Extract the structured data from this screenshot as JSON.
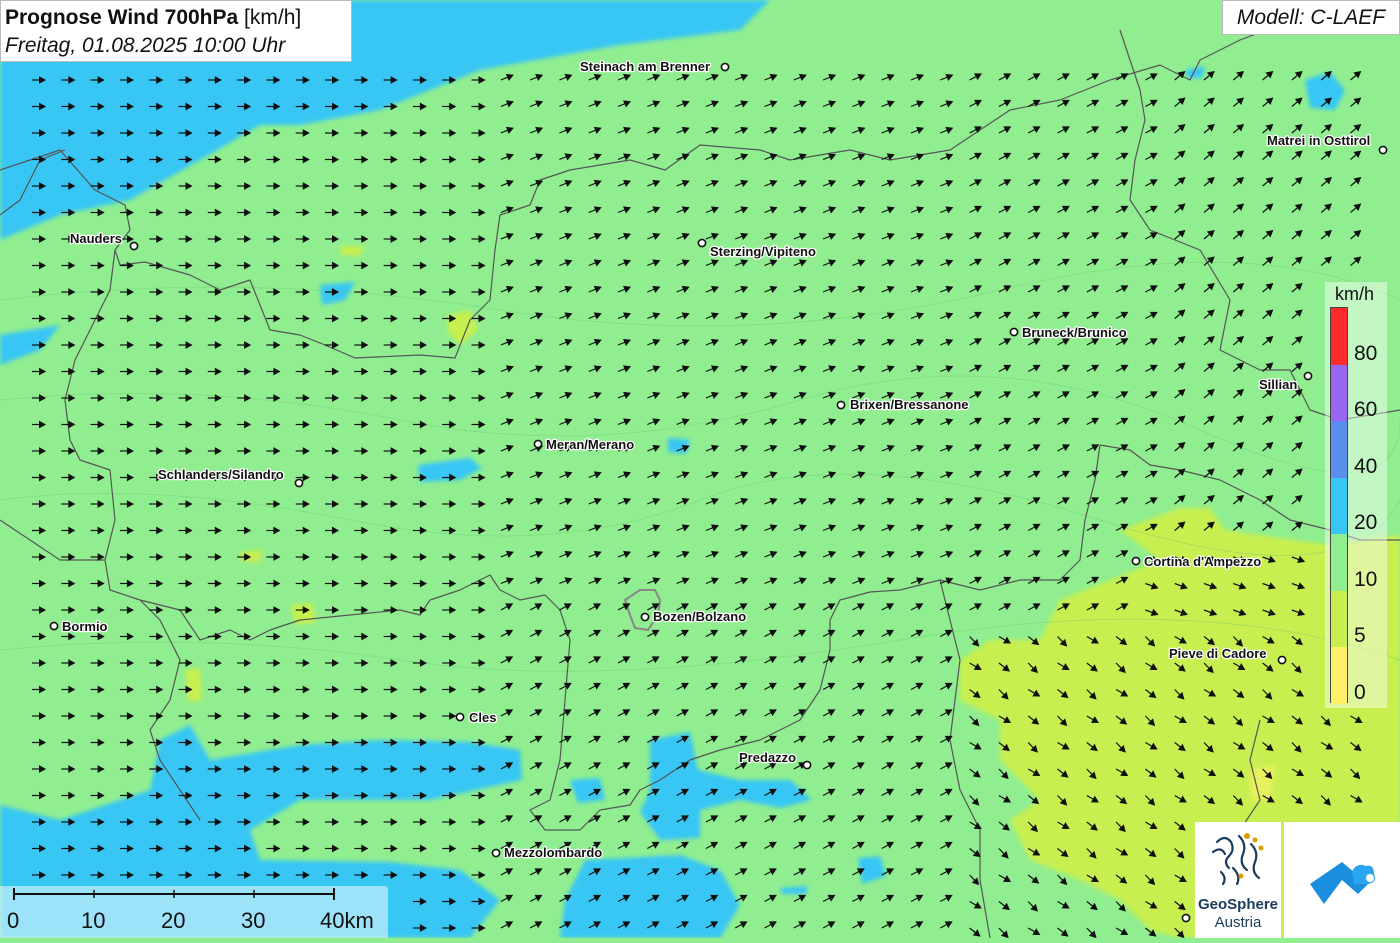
{
  "title": {
    "main": "Prognose Wind 700hPa",
    "unit": "[km/h]",
    "datetime": "Freitag, 01.08.2025 10:00 Uhr"
  },
  "model": "Modell: C-LAEF",
  "legend": {
    "unit": "km/h",
    "labels": [
      "80",
      "60",
      "40",
      "20",
      "10",
      "5",
      "0"
    ],
    "colors": [
      "#ff2b2b",
      "#9966ee",
      "#5b8def",
      "#38c6f4",
      "#90ee90",
      "#c7ef4f",
      "#fff06a"
    ]
  },
  "scale_bar": {
    "labels": [
      "0",
      "10",
      "20",
      "30",
      "40km"
    ]
  },
  "cities": [
    {
      "name": "Steinach am Brenner"
    },
    {
      "name": "Matrei in Osttirol"
    },
    {
      "name": "Nauders"
    },
    {
      "name": "Sterzing/Vipiteno"
    },
    {
      "name": "Bruneck/Brunico"
    },
    {
      "name": "Sillian"
    },
    {
      "name": "Brixen/Bressanone"
    },
    {
      "name": "Meran/Merano"
    },
    {
      "name": "Schlanders/Silandro"
    },
    {
      "name": "Cortina d'Ampezzo"
    },
    {
      "name": "Bozen/Bolzano"
    },
    {
      "name": "Bormio"
    },
    {
      "name": "Pieve di Cadore"
    },
    {
      "name": "Cles"
    },
    {
      "name": "Predazzo"
    },
    {
      "name": "Mezzolombardo"
    }
  ],
  "logos": {
    "geosphere_line1": "GeoSphere",
    "geosphere_line2": "Austria"
  },
  "colors": {
    "wind_10_20": "#90ee90",
    "wind_20_40": "#38c6f4",
    "wind_5_10": "#c7ef4f",
    "wind_0_5": "#fff06a",
    "border": "#555555",
    "arrow": "#111111"
  }
}
